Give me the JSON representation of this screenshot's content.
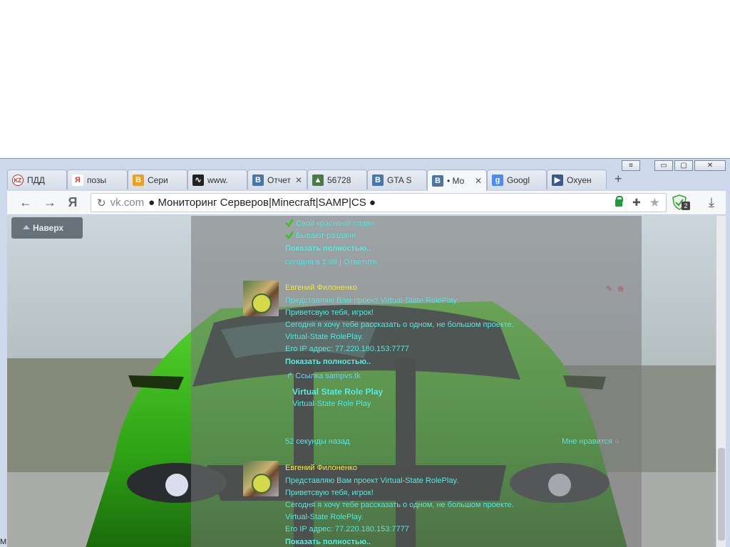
{
  "window": {
    "menu_icon": "menu-icon",
    "minimize_label": "▭",
    "restore_label": "▢",
    "close_label": "✕"
  },
  "tabs": [
    {
      "label": "ПДД",
      "icon": "kz-icon",
      "color": "#cc2b2b"
    },
    {
      "label": "позы",
      "icon": "yandex-icon",
      "color": "#e33"
    },
    {
      "label": "Сери",
      "icon": "b-icon",
      "color": "#f0a020"
    },
    {
      "label": "www.",
      "icon": "pulse-icon",
      "color": "#222"
    },
    {
      "label": "Отчет",
      "icon": "vk-icon",
      "color": "#4a76a8"
    },
    {
      "label": "56728",
      "icon": "car-icon",
      "color": "#4a7a4a"
    },
    {
      "label": "GTA S",
      "icon": "vk-icon",
      "color": "#4a76a8"
    },
    {
      "label": "• Мо",
      "icon": "vk-icon",
      "color": "#4a76a8"
    },
    {
      "label": "Googl",
      "icon": "google-icon",
      "color": "#4a8af4"
    },
    {
      "label": "Оxyeн",
      "icon": "play-icon",
      "color": "#3b5a8a"
    }
  ],
  "tab_x_label": "✕",
  "newtab_label": "+",
  "toolbar": {
    "back_label": "←",
    "forward_label": "→",
    "yandex_label": "Я",
    "reload_label": "↻",
    "host": "vk.com",
    "title": "● Мониторинг Серверов|Minecraft|SAMP|CS ●",
    "ext_label": "✚",
    "star_label": "★",
    "shield_badge": "2",
    "download_label": "⤓"
  },
  "page": {
    "up_button": "Наверх",
    "post1": {
      "bullets": [
        "Свой красивый спавн",
        "Бывают раздачи"
      ],
      "show_more": "Показать полностью..",
      "meta": "сегодня в 1:08 | Ответить"
    },
    "post2": {
      "author": "Евгений Филоненко",
      "lines": [
        "Представляю Вам проект Virtual-State RolePlay.",
        "Приветсвую тебя, игрок!",
        "Сегодня я хочу тебе рассказать о одном, не большом проекте.",
        "Virtual-State RolePlay.",
        "Его IP адрес: 77.220.180.153:7777"
      ],
      "show_more": "Показать полностью..",
      "link": "Ссылка sampvs.tk",
      "link_title": "Virtual State Role Play",
      "link_sub": "Virtual-State Role Play",
      "time": "52 секунды назад",
      "like": "Мне нравится"
    },
    "post3": {
      "author": "Евгений Филоненко",
      "lines": [
        "Представляю Вам проект Virtual-State RolePlay.",
        "Приветсвую тебя, игрок!",
        "Сегодня я хочу тебе рассказать о одном, не большом проекте.",
        "Virtual-State RolePlay.",
        "Его IP адрес: 77.220.180.153:7777"
      ],
      "show_more": "Показать полностью.."
    }
  },
  "colors": {
    "feed_text": "#5ff0e6",
    "author": "#f6f25a",
    "car_green": "#3cc21e"
  },
  "edge_letter": "M"
}
